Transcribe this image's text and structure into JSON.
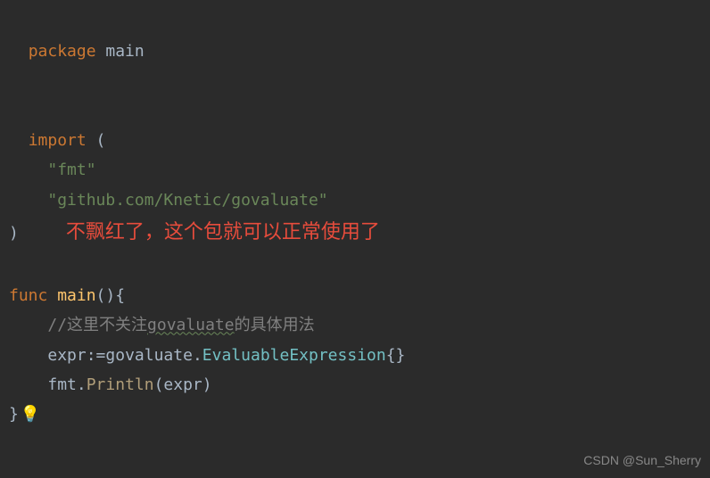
{
  "code": {
    "line1": {
      "keyword": "package",
      "name": " main"
    },
    "line3": {
      "keyword": "import",
      "paren": " ("
    },
    "line4": {
      "indent": "    ",
      "string": "\"fmt\""
    },
    "line5": {
      "indent": "    ",
      "string": "\"github.com/Knetic/govaluate\""
    },
    "line6": {
      "paren": ")",
      "annotation": "    不飘红了，这个包就可以正常使用了"
    },
    "line8": {
      "keyword": "func",
      "name": " main",
      "tail": "(){"
    },
    "line9": {
      "indent": "    ",
      "comment_pre": "//这里不关注",
      "comment_wavy": "govaluate",
      "comment_post": "的具体用法"
    },
    "line10": {
      "indent": "    ",
      "ident": "expr",
      "op": ":=",
      "pkg": "govaluate",
      "dot": ".",
      "type": "EvaluableExpression",
      "braces": "{}"
    },
    "line11": {
      "indent": "    ",
      "pkg": "fmt",
      "dot": ".",
      "method": "Println",
      "args": "(expr)"
    },
    "line12": {
      "brace": "}"
    }
  },
  "icons": {
    "lightbulb": "💡"
  },
  "watermark": "CSDN @Sun_Sherry"
}
